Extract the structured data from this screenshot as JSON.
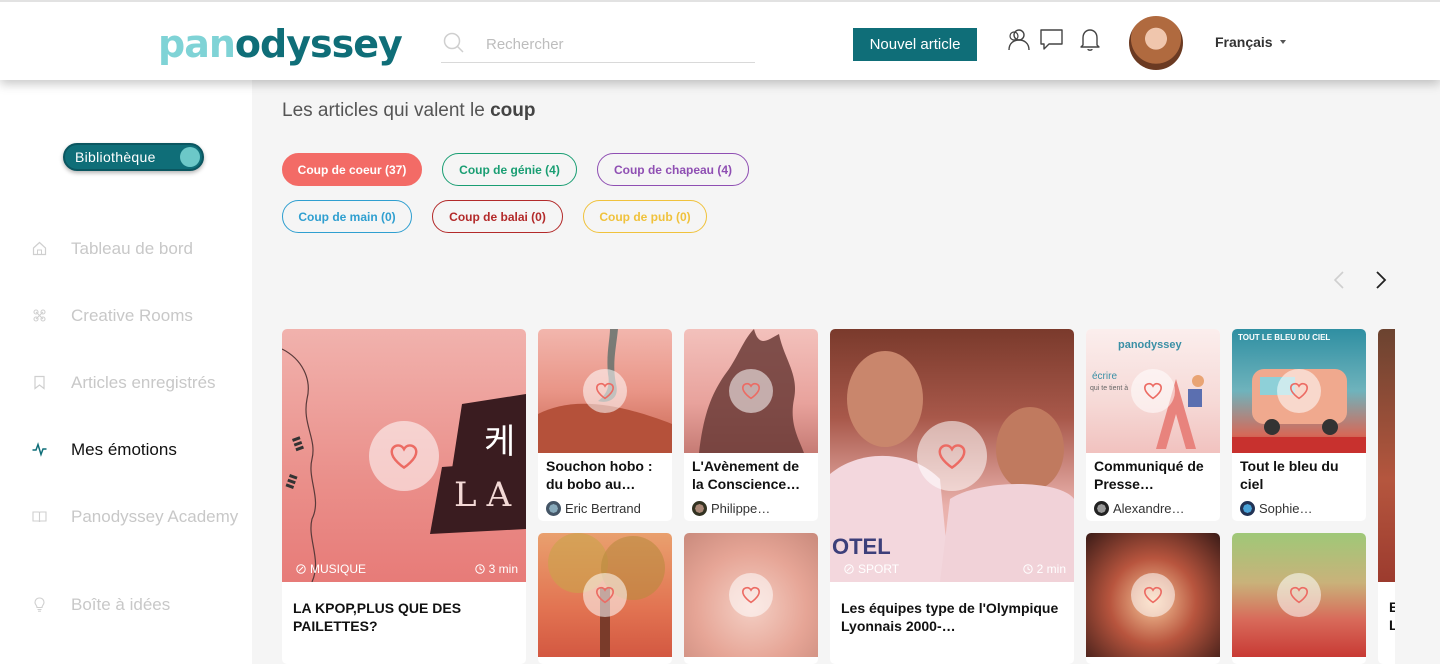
{
  "header": {
    "logo_part1": "pan",
    "logo_part2": "odyssey",
    "search_placeholder": "Rechercher",
    "new_article_label": "Nouvel article",
    "language": "Français"
  },
  "sidebar": {
    "toggle_label": "Bibliothèque",
    "items": [
      {
        "label": "Tableau de bord",
        "icon": "home-icon"
      },
      {
        "label": "Creative Rooms",
        "icon": "creative-icon"
      },
      {
        "label": "Articles enregistrés",
        "icon": "bookmark-icon"
      },
      {
        "label": "Mes émotions",
        "icon": "pulse-icon",
        "active": true
      },
      {
        "label": "Panodyssey Academy",
        "icon": "book-icon"
      },
      {
        "label": "Boîte à idées",
        "icon": "lightbulb-icon"
      }
    ]
  },
  "main": {
    "title_prefix": "Les articles qui valent le ",
    "title_bold": "coup",
    "chips": [
      {
        "label": "Coup de coeur (37)",
        "color": "#f36b66",
        "active": true
      },
      {
        "label": "Coup de génie (4)",
        "color": "#1a9e73"
      },
      {
        "label": "Coup de chapeau (4)",
        "color": "#8f4fb3"
      },
      {
        "label": "Coup de main (0)",
        "color": "#2f9fd0"
      },
      {
        "label": "Coup de balai (0)",
        "color": "#b32a2a"
      },
      {
        "label": "Coup de pub (0)",
        "color": "#f0c23c"
      }
    ],
    "large_cards": [
      {
        "category": "MUSIQUE",
        "duration": "3 min",
        "title": "LA KPOP,PLUS QUE DES PAILETTES?",
        "overlay_text_1": "케",
        "overlay_text_2": "LA "
      },
      {
        "category": "SPORT",
        "duration": "2 min",
        "title": "Les équipes type de l'Olympique Lyonnais 2000-…",
        "overlay_text_1": "OTEL"
      }
    ],
    "small_cards": [
      {
        "title": "Souchon hobo : du bobo au…",
        "author": "Eric Bertrand"
      },
      {
        "title": "L'Avènement de la Conscience…",
        "author": "Philippe…"
      },
      {
        "title": "Communiqué de Presse…",
        "author": "Alexandre…",
        "image_text_1": "panodyssey",
        "image_text_2": "écrire",
        "image_text_3": "qui te tient à"
      },
      {
        "title": "Tout le bleu du ciel",
        "author": "Sophie…",
        "image_text_1": "TOUT LE BLEU DU CIEL"
      }
    ],
    "partial_text": [
      "E",
      "L"
    ]
  }
}
